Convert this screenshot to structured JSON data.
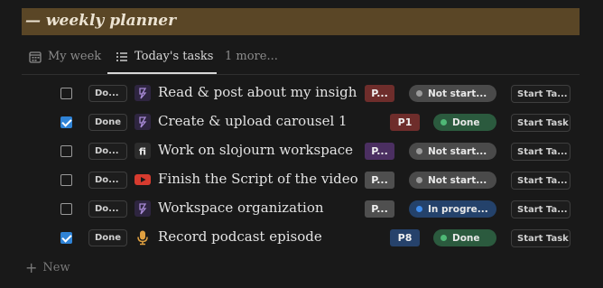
{
  "banner": {
    "title": "— weekly planner"
  },
  "tabs": [
    {
      "label": "My week",
      "icon": "calendar-icon",
      "active": false
    },
    {
      "label": "Today's tasks",
      "icon": "list-icon",
      "active": true
    },
    {
      "label": "1 more...",
      "active": false
    }
  ],
  "rows": [
    {
      "checked": false,
      "done_label": "Do...",
      "icon": "notion-logo-icon",
      "title": "Read & post about my insigh...",
      "priority": "P...",
      "priority_color": "#6e2d2b",
      "status": "Not start...",
      "status_bg": "#4a4a4a",
      "status_dot": "#9a9a9a",
      "start_label": "Start Ta..."
    },
    {
      "checked": true,
      "done_label": "Done",
      "icon": "notion-logo-icon",
      "title": "Create & upload carousel 1",
      "priority": "P1",
      "priority_color": "#6e2d2b",
      "status": "Done",
      "status_bg": "#2b5a3e",
      "status_dot": "#4fb876",
      "start_label": "Start Task"
    },
    {
      "checked": false,
      "done_label": "Do...",
      "icon": "fi-icon",
      "title": "Work on slojourn workspace",
      "priority": "P...",
      "priority_color": "#4b2f61",
      "status": "Not start...",
      "status_bg": "#4a4a4a",
      "status_dot": "#9a9a9a",
      "start_label": "Start Ta..."
    },
    {
      "checked": false,
      "done_label": "Do...",
      "icon": "youtube-icon",
      "title": "Finish the Script of the video",
      "priority": "P...",
      "priority_color": "#4f4f4f",
      "status": "Not start...",
      "status_bg": "#4a4a4a",
      "status_dot": "#9a9a9a",
      "start_label": "Start Ta..."
    },
    {
      "checked": false,
      "done_label": "Do...",
      "icon": "notion-logo-icon",
      "title": "Workspace organization",
      "priority": "P...",
      "priority_color": "#4f4f4f",
      "status": "In progre...",
      "status_bg": "#24426b",
      "status_dot": "#3f8cec",
      "start_label": "Start Ta..."
    },
    {
      "checked": true,
      "done_label": "Done",
      "icon": "microphone-icon",
      "title": "Record podcast episode",
      "priority": "P8",
      "priority_color": "#26426b",
      "status": "Done",
      "status_bg": "#2b5a3e",
      "status_dot": "#4fb876",
      "start_label": "Start Task"
    }
  ],
  "new_row": {
    "label": "New"
  }
}
